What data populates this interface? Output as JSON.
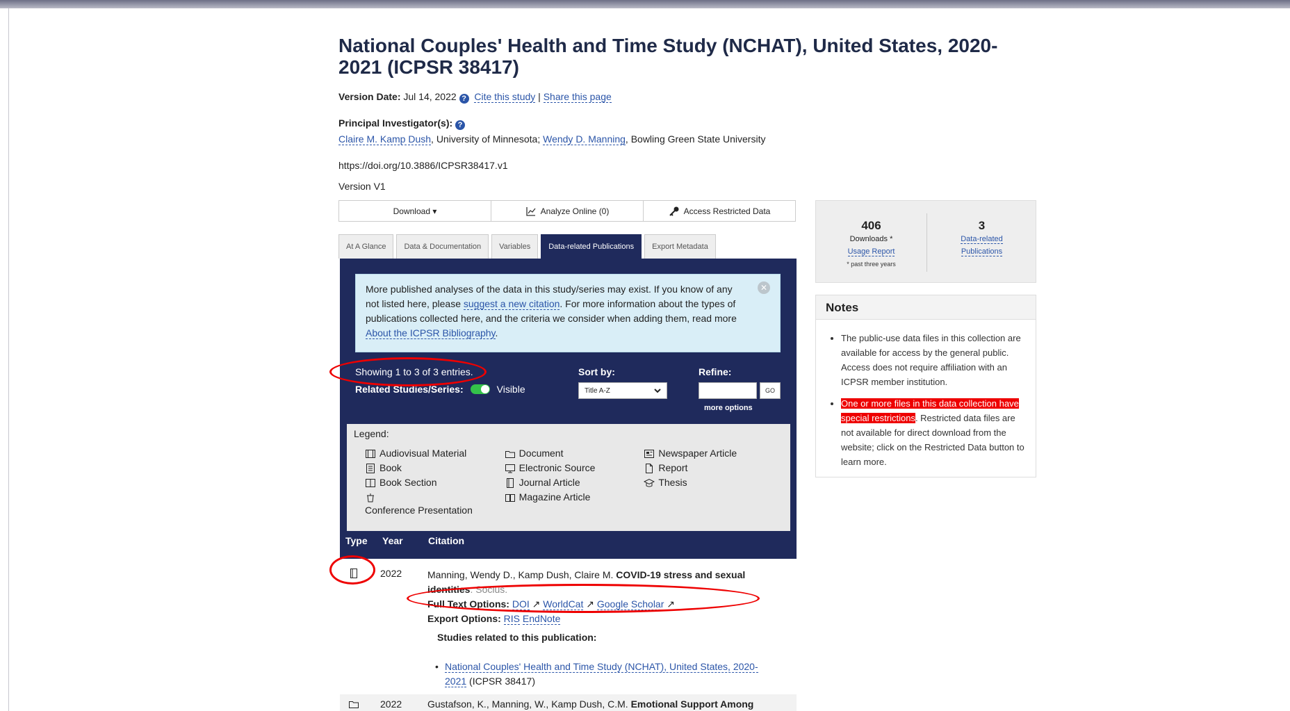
{
  "study": {
    "title": "National Couples' Health and Time Study (NCHAT), United States, 2020-2021 (ICPSR 38417)",
    "version_date_label": "Version Date:",
    "version_date": "Jul 14, 2022",
    "cite_link": "Cite this study",
    "separator": "|",
    "share_link": "Share this page",
    "pi_label": "Principal Investigator(s):",
    "pi1_name": "Claire M. Kamp Dush",
    "pi1_affil": ", University of Minnesota;",
    "pi2_name": "Wendy D. Manning",
    "pi2_affil": ", Bowling Green State University",
    "doi": "https://doi.org/10.3886/ICPSR38417.v1",
    "version": "Version V1"
  },
  "actions": {
    "download": "Download ▾",
    "analyze": "Analyze Online (0)",
    "restricted": "Access Restricted Data"
  },
  "tabs": [
    {
      "label": "At A Glance"
    },
    {
      "label": "Data & Documentation"
    },
    {
      "label": "Variables"
    },
    {
      "label": "Data-related Publications"
    },
    {
      "label": "Export Metadata"
    }
  ],
  "info": {
    "t1": "More published analyses of the data in this study/series may exist. If you know of any not listed here, please ",
    "suggest": "suggest a new citation",
    "t2": ". For more information about the types of publications collected here, and the criteria we consider when adding them, read more ",
    "about": "About the ICPSR Bibliography",
    "t3": "."
  },
  "controls": {
    "showing": "Showing 1 to 3 of 3 entries.",
    "related_label": "Related Studies/Series:",
    "related_value": "Visible",
    "sort_label": "Sort by:",
    "sort_value": "Title A-Z",
    "refine_label": "Refine:",
    "go": "GO",
    "more_options": "more options"
  },
  "legend": {
    "title": "Legend:",
    "col1": [
      "Audiovisual Material",
      "Book",
      "Book Section",
      "Conference Presentation"
    ],
    "col2": [
      "Document",
      "Electronic Source",
      "Journal Article",
      "Magazine Article"
    ],
    "col3": [
      "Newspaper Article",
      "Report",
      "Thesis"
    ]
  },
  "table": {
    "headers": [
      "Type",
      "Year",
      "Citation"
    ],
    "row1": {
      "year": "2022",
      "authors": "Manning, Wendy D., Kamp Dush, Claire M. ",
      "title": "COVID-19 stress and sexual identities",
      "journal": ". Socius.",
      "fulltext_label": "Full Text Options:",
      "doi": "DOI",
      "worldcat": "WorldCat",
      "scholar": "Google Scholar",
      "export_label": "Export Options:",
      "ris": "RIS",
      "endnote": "EndNote",
      "studies_label": "Studies related to this publication:",
      "related_study": "National Couples' Health and Time Study (NCHAT), United States, 2020-2021",
      "related_id": " (ICPSR 38417)"
    },
    "row2": {
      "year": "2022",
      "authors": "Gustafson, K., Manning, W., Kamp Dush, C.M. ",
      "title": "Emotional Support Among"
    }
  },
  "stats": {
    "downloads": "406",
    "downloads_label": "Downloads *",
    "usage": "Usage Report",
    "note": "* past three years",
    "pubs": "3",
    "pubs_label1": "Data-related",
    "pubs_label2": "Publications"
  },
  "notes": {
    "title": "Notes",
    "n1": "The public-use data files in this collection are available for access by the general public. Access does not require affiliation with an ICPSR member institution.",
    "n2_hl": "One or more files in this data collection have special restrictions",
    "n2_rest": ". Restricted data files are not available for direct download from the website; click on the Restricted Data button to learn more."
  },
  "colors": {
    "navy": "#1f2a5c",
    "link": "#2b55a8",
    "annotation": "#e00000"
  }
}
